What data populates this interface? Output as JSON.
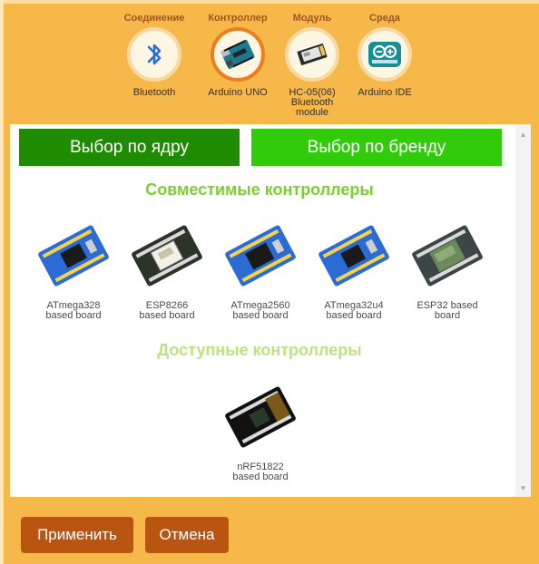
{
  "steps": [
    {
      "title": "Соединение",
      "label": "Bluetooth",
      "icon": "bluetooth-icon"
    },
    {
      "title": "Контроллер",
      "label": "Arduino UNO",
      "icon": "arduino-uno-board-icon",
      "active": true
    },
    {
      "title": "Модуль",
      "label": "HC-05(06) Bluetooth module",
      "label_lines": [
        "HC-05(06)",
        "Bluetooth",
        "module"
      ],
      "icon": "hc05-module-icon"
    },
    {
      "title": "Среда",
      "label": "Arduino IDE",
      "icon": "arduino-ide-logo-icon"
    }
  ],
  "tabs": {
    "core": "Выбор по ядру",
    "brand": "Выбор по бренду"
  },
  "sections": {
    "compatible": "Совместимые контроллеры",
    "available": "Доступные контроллеры"
  },
  "compatible_controllers": [
    {
      "line1": "ATmega328",
      "line2": "based board",
      "board_color": "#2b6cd4"
    },
    {
      "line1": "ESP8266",
      "line2": "based board",
      "board_color": "#2c3327"
    },
    {
      "line1": "ATmega2560",
      "line2": "based board",
      "board_color": "#2b6cd4"
    },
    {
      "line1": "ATmega32u4",
      "line2": "based board",
      "board_color": "#2b6cd4"
    },
    {
      "line1": "ESP32 based",
      "line2": "board",
      "board_color": "#3d4646"
    }
  ],
  "available_controllers": [
    {
      "line1": "nRF51822",
      "line2": "based board",
      "board_color": "#111111"
    }
  ],
  "buttons": {
    "apply": "Применить",
    "cancel": "Отмена"
  },
  "colors": {
    "background": "#f7b84a",
    "tab_core": "#1e8b00",
    "tab_brand": "#31cb0b",
    "button": "#b95511",
    "step_active_ring": "#ee7d1e",
    "section_title": "#7ccf2f"
  }
}
